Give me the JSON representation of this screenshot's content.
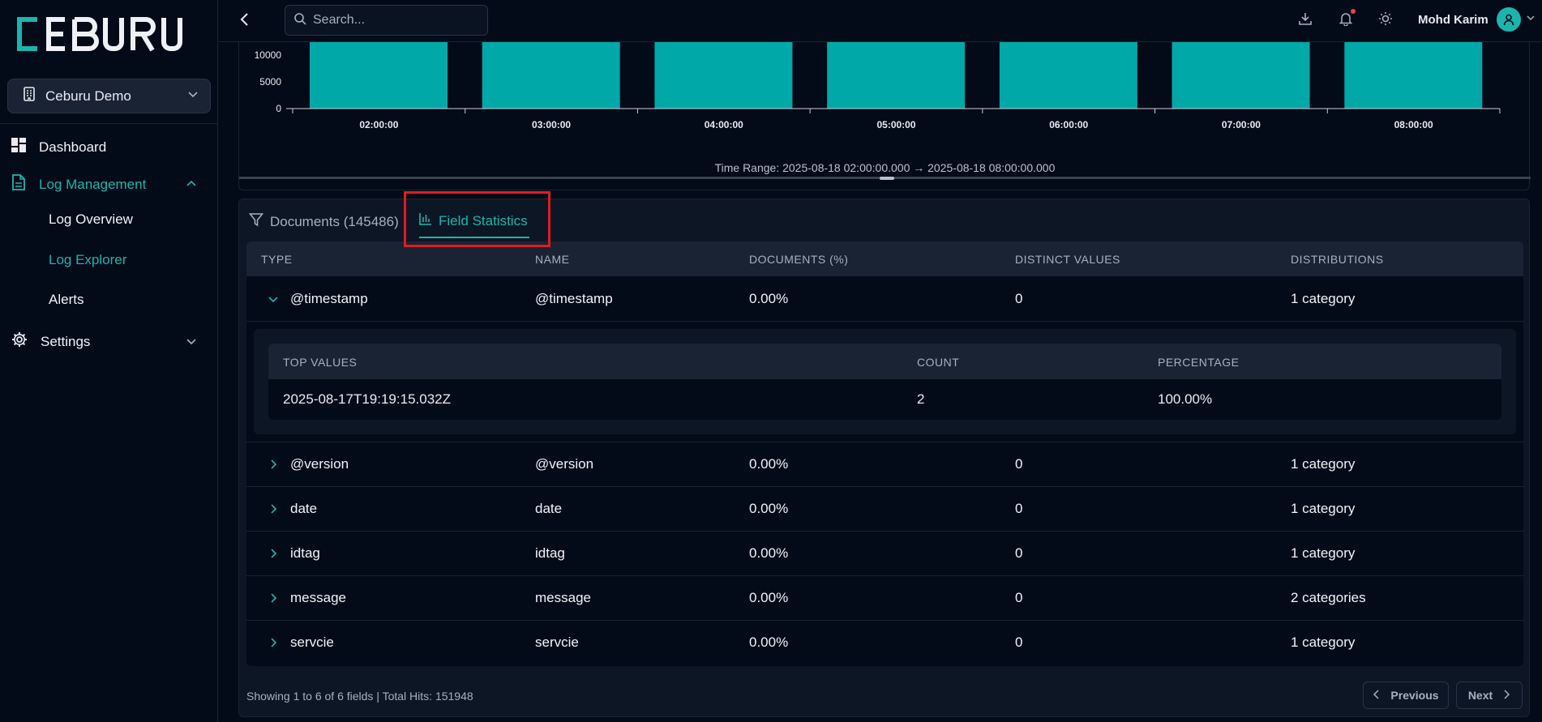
{
  "app": {
    "brand": "CEBURU",
    "org_name": "Ceburu Demo"
  },
  "sidebar": {
    "items": [
      {
        "label": "Dashboard"
      },
      {
        "label": "Log Management"
      },
      {
        "label": "Settings"
      }
    ],
    "sub_items": [
      {
        "label": "Log Overview"
      },
      {
        "label": "Log Explorer"
      },
      {
        "label": "Alerts"
      }
    ]
  },
  "topbar": {
    "search_placeholder": "Search...",
    "user_name": "Mohd Karim"
  },
  "chart_data": {
    "type": "bar",
    "categories": [
      "02:00:00",
      "03:00:00",
      "04:00:00",
      "05:00:00",
      "06:00:00",
      "07:00:00",
      "08:00:00"
    ],
    "y_ticks": [
      "10000",
      "5000",
      "0"
    ],
    "ylim": [
      0,
      10000
    ],
    "footer": "Time Range: 2025-08-18 02:00:00.000 → 2025-08-18 08:00:00.000",
    "bar_color": "#00a8a8"
  },
  "tabs": [
    {
      "label": "Documents (145486)"
    },
    {
      "label": "Field Statistics"
    }
  ],
  "table": {
    "headers": [
      "TYPE",
      "NAME",
      "DOCUMENTS (%)",
      "DISTINCT VALUES",
      "DISTRIBUTIONS"
    ],
    "rows": [
      {
        "type": "@timestamp",
        "name": "@timestamp",
        "docs": "0.00%",
        "distinct": "0",
        "dist": "1 category"
      },
      {
        "type": "@version",
        "name": "@version",
        "docs": "0.00%",
        "distinct": "0",
        "dist": "1 category"
      },
      {
        "type": "date",
        "name": "date",
        "docs": "0.00%",
        "distinct": "0",
        "dist": "1 category"
      },
      {
        "type": "idtag",
        "name": "idtag",
        "docs": "0.00%",
        "distinct": "0",
        "dist": "1 category"
      },
      {
        "type": "message",
        "name": "message",
        "docs": "0.00%",
        "distinct": "0",
        "dist": "2 categories"
      },
      {
        "type": "servcie",
        "name": "servcie",
        "docs": "0.00%",
        "distinct": "0",
        "dist": "1 category"
      }
    ],
    "expanded": {
      "headers": [
        "TOP VALUES",
        "COUNT",
        "PERCENTAGE"
      ],
      "rows": [
        {
          "value": "2025-08-17T19:19:15.032Z",
          "count": "2",
          "pct": "100.00%"
        }
      ]
    }
  },
  "footer": {
    "summary": "Showing 1 to 6 of 6 fields | Total Hits: 151948",
    "prev_label": "Previous",
    "next_label": "Next"
  },
  "colors": {
    "accent": "#1bb5ad",
    "highlight": "#e11b22"
  }
}
